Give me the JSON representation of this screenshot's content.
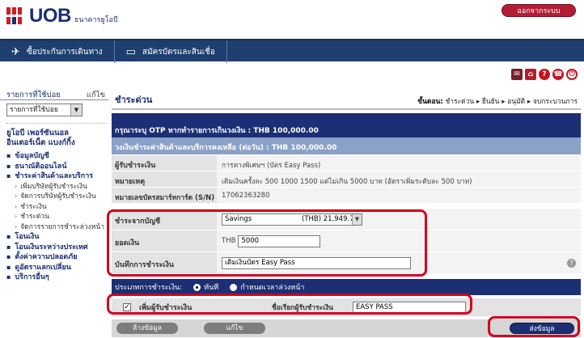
{
  "header": {
    "logo_text": "UOB",
    "logo_sub": "ธนาคารยูโอบี",
    "logout_label": "ออกจากระบบ"
  },
  "nav": {
    "items": [
      {
        "icon": "✈",
        "label": "ซื้อประกันการเดินทาง"
      },
      {
        "icon": "▭",
        "label": "สมัครบัตรและสินเชื่อ"
      }
    ]
  },
  "sidebar": {
    "favorites_title": "รายการที่ใช้บ่อย",
    "edit_label": "แก้ไข",
    "favorites_select": "รายการที่ใช้บ่อย",
    "section_title_1": "ยูโอบี เพอร์ซันนอล",
    "section_title_2": "อินเตอร์เน็ต แบงก์กิ้ง",
    "menu": [
      {
        "label": "ข้อมูลบัญชี",
        "sub": false
      },
      {
        "label": "ธนาณัติออนไลน์",
        "sub": false
      },
      {
        "label": "ชำระค่าสินค้าและบริการ",
        "sub": false
      },
      {
        "label": "เพิ่มบริษัทผู้รับชำระเงิน",
        "sub": true
      },
      {
        "label": "จัดการบริษัทผู้รับชำระเงิน",
        "sub": true
      },
      {
        "label": "ชำระเงิน",
        "sub": true
      },
      {
        "label": "ชำระด่วน",
        "sub": true
      },
      {
        "label": "จัดการรายการชำระล่วงหน้า",
        "sub": true
      },
      {
        "label": "โอนเงิน",
        "sub": false
      },
      {
        "label": "โอนเงินระหว่างประเทศ",
        "sub": false
      },
      {
        "label": "ตั้งค่าความปลอดภัย",
        "sub": false
      },
      {
        "label": "ดูอัตราแลกเปลี่ยน",
        "sub": false
      },
      {
        "label": "บริการอื่นๆ",
        "sub": false
      }
    ]
  },
  "main": {
    "title": "ชำระด่วน",
    "steps_prefix": "ขั้นตอน:",
    "steps": "ชำระด่วน ▸ ยืนยัน ▸ อนุมัติ ▸ จบกระบวนการ",
    "otp_notice": "กรุณาระบุ OTP หากทำรายการเกินวงเงิน : THB 100,000.00",
    "limit_notice": "วงเงินชำระค่าสินค้าและบริการคงเหลือ (ต่อวัน) : THB 100,000.00",
    "biller_label": "ผู้รับชำระเงิน",
    "biller_value": "การทางพิเศษฯ (บัตร Easy Pass)",
    "note_label": "หมายเหตุ",
    "note_value": "เติมเงินครั้งละ 500 1000 1500 แต่ไม่เกิน 5000 บาท (อัตราเพิ่มระดับละ 500 บาท)",
    "card_label": "หมายเลขบัตรสมาร์ทการ์ด (S/N)",
    "card_value": "17062363280",
    "from_account_label": "ชำระจากบัญชี",
    "from_account_name": "Savings",
    "from_account_balance": "(THB) 21,949.70",
    "amount_label": "ยอดเงิน",
    "amount_currency": "THB",
    "amount_value": "5000",
    "memo_label": "บันทึกการชำระเงิน",
    "memo_value": "เติมเงินบัตร Easy Pass",
    "payment_type_label": "ประเภทการชำระเงิน:",
    "payment_type_now": "ทันที",
    "payment_type_schedule": "กำหนดเวลาล่วงหน้า",
    "add_payee_label": "เพิ่มผู้รับชำระเงิน",
    "payee_nickname_label": "ชื่อเรียกผู้รับชำระเงิน",
    "payee_nickname_value": "EASY PASS",
    "clear_button": "ล้างข้อมูล",
    "edit_button": "แก้ไข",
    "submit_button": "ส่งข้อมูล"
  },
  "colors": {
    "brand_navy": "#1c2f74",
    "brand_red": "#d71920",
    "highlight": "#d4001c"
  }
}
